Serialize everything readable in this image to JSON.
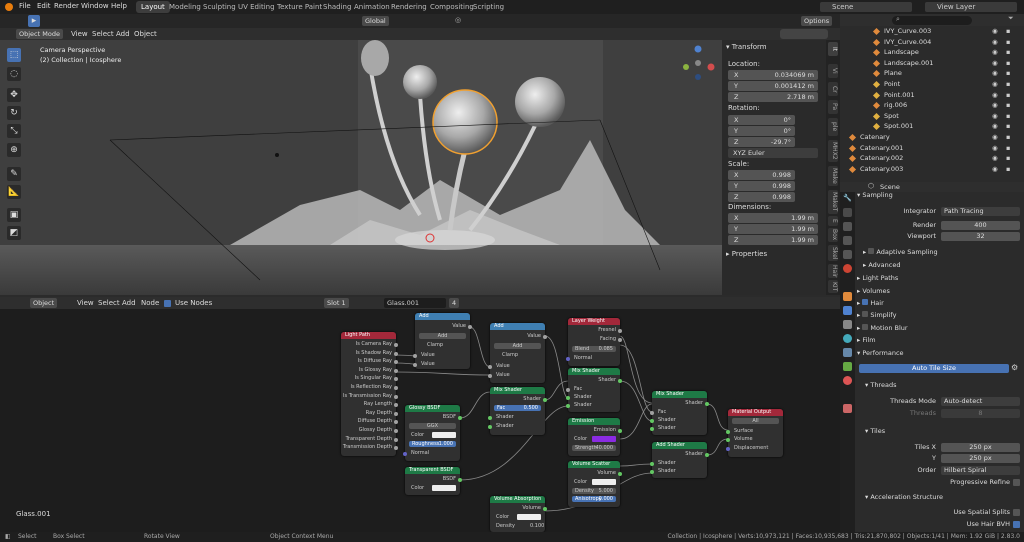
{
  "topmenu": [
    "File",
    "Edit",
    "Render",
    "Window",
    "Help"
  ],
  "workspaces": [
    "Layout",
    "Modeling",
    "Sculpting",
    "UV Editing",
    "Texture Paint",
    "Shading",
    "Animation",
    "Rendering",
    "Compositing",
    "Scripting"
  ],
  "scene": "Scene",
  "view_layer": "View Layer",
  "viewport": {
    "mode": "Object Mode",
    "menus": [
      "View",
      "Select",
      "Add",
      "Object"
    ],
    "orientation": "Global",
    "options": "Options",
    "overlay_title": "Camera Perspective",
    "overlay_sub": "(2) Collection | Icosphere"
  },
  "npanel": {
    "transform": "Transform",
    "location": "Location:",
    "loc": [
      [
        "X",
        "0.034069 m"
      ],
      [
        "Y",
        "0.001412 m"
      ],
      [
        "Z",
        "2.718 m"
      ]
    ],
    "rotation": "Rotation:",
    "rot": [
      [
        "X",
        "0°"
      ],
      [
        "Y",
        "0°"
      ],
      [
        "Z",
        "-29.7°"
      ]
    ],
    "rot_mode": "XYZ Euler",
    "scale": "Scale:",
    "scl": [
      [
        "X",
        "0.998"
      ],
      [
        "Y",
        "0.998"
      ],
      [
        "Z",
        "0.998"
      ]
    ],
    "dimensions": "Dimensions:",
    "dim": [
      [
        "X",
        "1.99 m"
      ],
      [
        "Y",
        "1.99 m"
      ],
      [
        "Z",
        "1.99 m"
      ]
    ],
    "properties": "Properties",
    "tabs": [
      "It",
      "Vi",
      "Cr",
      "Pa",
      "ple",
      "MHX2",
      "Make",
      "MakeT",
      "E",
      "Box",
      "Skel",
      "Hair",
      "KIT"
    ]
  },
  "outliner": [
    {
      "name": "IVY_Curve.003",
      "c": "#e08a3c"
    },
    {
      "name": "IVY_Curve.004",
      "c": "#e08a3c"
    },
    {
      "name": "Landscape",
      "c": "#e08a3c"
    },
    {
      "name": "Landscape.001",
      "c": "#e08a3c"
    },
    {
      "name": "Plane",
      "c": "#e08a3c"
    },
    {
      "name": "Point",
      "c": "#e0b040"
    },
    {
      "name": "Point.001",
      "c": "#e0b040"
    },
    {
      "name": "rig.006",
      "c": "#e08a3c"
    },
    {
      "name": "Spot",
      "c": "#e0b040"
    },
    {
      "name": "Spot.001",
      "c": "#e0b040"
    },
    {
      "name": "Catenary",
      "c": "#e08a3c"
    },
    {
      "name": "Catenary.001",
      "c": "#e08a3c"
    },
    {
      "name": "Catenary.002",
      "c": "#e08a3c"
    },
    {
      "name": "Catenary.003",
      "c": "#e08a3c"
    }
  ],
  "props": {
    "scene": "Scene",
    "sampling": "Sampling",
    "integrator_l": "Integrator",
    "integrator": "Path Tracing",
    "render_l": "Render",
    "render": "400",
    "viewport_l": "Viewport",
    "viewport": "32",
    "adaptive": "Adaptive Sampling",
    "advanced": "Advanced",
    "light_paths": "Light Paths",
    "volumes": "Volumes",
    "hair": "Hair",
    "simplify": "Simplify",
    "motion_blur": "Motion Blur",
    "film": "Film",
    "performance": "Performance",
    "auto_tile": "Auto Tile Size",
    "threads": "Threads",
    "threads_mode_l": "Threads Mode",
    "threads_mode": "Auto-detect",
    "threads_l": "Threads",
    "threads_v": "8",
    "tiles": "Tiles",
    "tiles_x_l": "Tiles X",
    "tiles_x": "250 px",
    "y_l": "Y",
    "tiles_y": "250 px",
    "order_l": "Order",
    "order": "Hilbert Spiral",
    "progressive": "Progressive Refine",
    "accel": "Acceleration Structure",
    "spatial": "Use Spatial Splits",
    "hair_bvh": "Use Hair BVH"
  },
  "node_editor": {
    "type": "Object",
    "menus": [
      "View",
      "Select",
      "Add",
      "Node"
    ],
    "use_nodes": "Use Nodes",
    "slot": "Slot 1",
    "material": "Glass.001",
    "users": "4",
    "label": "Glass.001"
  },
  "nodes": {
    "light_path": {
      "title": "Light Path",
      "outs": [
        "Is Camera Ray",
        "Is Shadow Ray",
        "Is Diffuse Ray",
        "Is Glossy Ray",
        "Is Singular Ray",
        "Is Reflection Ray",
        "Is Transmission Ray",
        "Ray Length",
        "Ray Depth",
        "Diffuse Depth",
        "Glossy Depth",
        "Transparent Depth",
        "Transmission Depth"
      ]
    },
    "add1": {
      "title": "Add",
      "out": "Value",
      "op": "Add",
      "clamp": "Clamp",
      "ins": [
        "Value",
        "Value"
      ]
    },
    "add2": {
      "title": "Add",
      "out": "Value",
      "op": "Add",
      "clamp": "Clamp",
      "ins": [
        "Value",
        "Value"
      ]
    },
    "layer_weight": {
      "title": "Layer Weight",
      "outs": [
        "Fresnel",
        "Facing"
      ],
      "blend_l": "Blend",
      "blend": "0.085",
      "normal": "Normal"
    },
    "mix1": {
      "title": "Mix Shader",
      "out": "Shader",
      "fac": "Fac",
      "fac_v": "0.500",
      "ins": [
        "Shader",
        "Shader"
      ]
    },
    "mix2": {
      "title": "Mix Shader",
      "out": "Shader",
      "ins": [
        "Fac",
        "Shader",
        "Shader"
      ]
    },
    "mix3": {
      "title": "Mix Shader",
      "out": "Shader",
      "ins": [
        "Fac",
        "Shader",
        "Shader"
      ]
    },
    "glossy": {
      "title": "Glossy BSDF",
      "out": "BSDF",
      "dist": "GGX",
      "ins": [
        "Color",
        "Roughness",
        "Normal"
      ],
      "rough": "1.000"
    },
    "emission": {
      "title": "Emission",
      "out": "Emission",
      "ins": [
        "Color",
        "Strength"
      ],
      "strength": "40.000"
    },
    "volume_scatter": {
      "title": "Volume Scatter",
      "out": "Volume",
      "ins": [
        "Color",
        "Density",
        "Anisotropy"
      ],
      "density": "5.000",
      "aniso": "0.000"
    },
    "add_shader": {
      "title": "Add Shader",
      "out": "Shader",
      "ins": [
        "Shader",
        "Shader"
      ]
    },
    "material_output": {
      "title": "Material Output",
      "target": "All",
      "ins": [
        "Surface",
        "Volume",
        "Displacement"
      ]
    },
    "transparent": {
      "title": "Transparent BSDF",
      "out": "BSDF",
      "ins": [
        "Color"
      ]
    },
    "volume_abs": {
      "title": "Volume Absorption",
      "out": "Volume",
      "ins": [
        "Color",
        "Density"
      ],
      "density": "0.100"
    }
  },
  "status": {
    "left": [
      "Select",
      "Box Select",
      "Rotate View",
      "Object Context Menu"
    ],
    "right": "Collection | Icosphere | Verts:10,973,121 | Faces:10,935,683 | Tris:21,870,802 | Objects:1/41 | Mem: 1.92 GiB | 2.83.0"
  }
}
